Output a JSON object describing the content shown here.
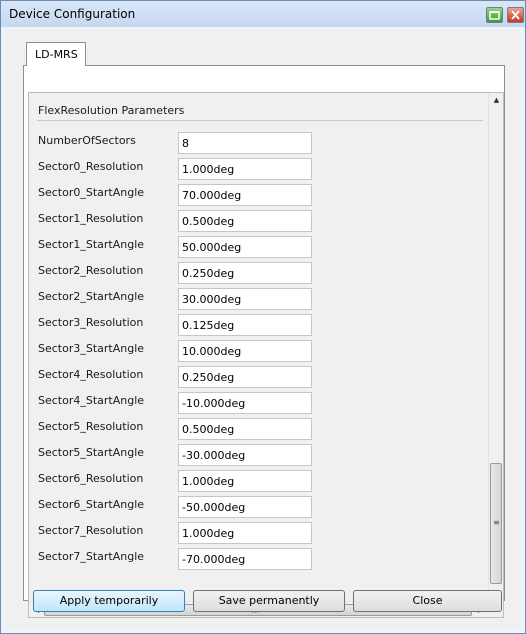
{
  "window": {
    "title": "Device Configuration"
  },
  "tabs": [
    {
      "label": "LD-MRS"
    }
  ],
  "group": {
    "title": "FlexResolution Parameters"
  },
  "params": [
    {
      "label": "NumberOfSectors",
      "value": "8"
    },
    {
      "label": "Sector0_Resolution",
      "value": "1.000deg"
    },
    {
      "label": "Sector0_StartAngle",
      "value": "70.000deg"
    },
    {
      "label": "Sector1_Resolution",
      "value": "0.500deg"
    },
    {
      "label": "Sector1_StartAngle",
      "value": "50.000deg"
    },
    {
      "label": "Sector2_Resolution",
      "value": "0.250deg"
    },
    {
      "label": "Sector2_StartAngle",
      "value": "30.000deg"
    },
    {
      "label": "Sector3_Resolution",
      "value": "0.125deg"
    },
    {
      "label": "Sector3_StartAngle",
      "value": "10.000deg"
    },
    {
      "label": "Sector4_Resolution",
      "value": "0.250deg"
    },
    {
      "label": "Sector4_StartAngle",
      "value": "-10.000deg"
    },
    {
      "label": "Sector5_Resolution",
      "value": "0.500deg"
    },
    {
      "label": "Sector5_StartAngle",
      "value": "-30.000deg"
    },
    {
      "label": "Sector6_Resolution",
      "value": "1.000deg"
    },
    {
      "label": "Sector6_StartAngle",
      "value": "-50.000deg"
    },
    {
      "label": "Sector7_Resolution",
      "value": "1.000deg"
    },
    {
      "label": "Sector7_StartAngle",
      "value": "-70.000deg"
    }
  ],
  "buttons": {
    "apply": "Apply temporarily",
    "save": "Save permanently",
    "close": "Close"
  },
  "icons": {
    "minimize": "green-window-icon",
    "close": "red-close-icon"
  },
  "colors": {
    "titlebar": "#c5d8f0",
    "primary_button": "#bee6fd"
  }
}
